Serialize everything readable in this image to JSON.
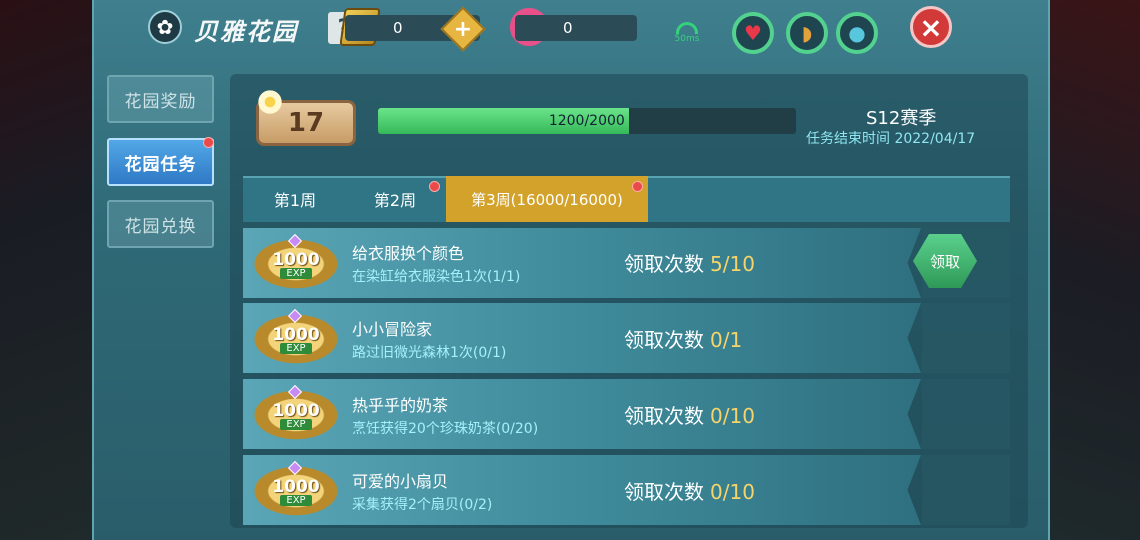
{
  "header": {
    "title": "贝雅花园",
    "help_label": "?",
    "gem_amount": "0",
    "flower_amount": "0",
    "plus_label": "+",
    "ping": "50ms",
    "close_label": "×"
  },
  "sidebar": {
    "items": [
      {
        "label": "花园奖励"
      },
      {
        "label": "花园任务"
      },
      {
        "label": "花园兑换"
      }
    ]
  },
  "level": {
    "value": "17"
  },
  "progress": {
    "text": "1200/2000",
    "current": 1200,
    "total": 2000
  },
  "season": {
    "title": "S12赛季",
    "end_text": "任务结束时间 2022/04/17"
  },
  "tabs": [
    {
      "label": "第1周"
    },
    {
      "label": "第2周"
    },
    {
      "label": "第3周(16000/16000)"
    }
  ],
  "tasks": [
    {
      "reward": "1000",
      "exp": "EXP",
      "name": "给衣服换个颜色",
      "desc": "在染缸给衣服染色1次(1/1)",
      "count_label": "领取次数",
      "count": "5/10"
    },
    {
      "reward": "1000",
      "exp": "EXP",
      "name": "小小冒险家",
      "desc": "路过旧微光森林1次(0/1)",
      "count_label": "领取次数",
      "count": "0/1"
    },
    {
      "reward": "1000",
      "exp": "EXP",
      "name": "热乎乎的奶茶",
      "desc": "烹饪获得20个珍珠奶茶(0/20)",
      "count_label": "领取次数",
      "count": "0/10"
    },
    {
      "reward": "1000",
      "exp": "EXP",
      "name": "可爱的小扇贝",
      "desc": "采集获得2个扇贝(0/2)",
      "count_label": "领取次数",
      "count": "0/10"
    }
  ],
  "claim_button": {
    "label": "领取"
  },
  "colors": {
    "accent_green": "#36b85a",
    "tab_active": "#d3a22b",
    "sidebar_active": "#2f79c6",
    "notification_red": "#e94b4b"
  }
}
